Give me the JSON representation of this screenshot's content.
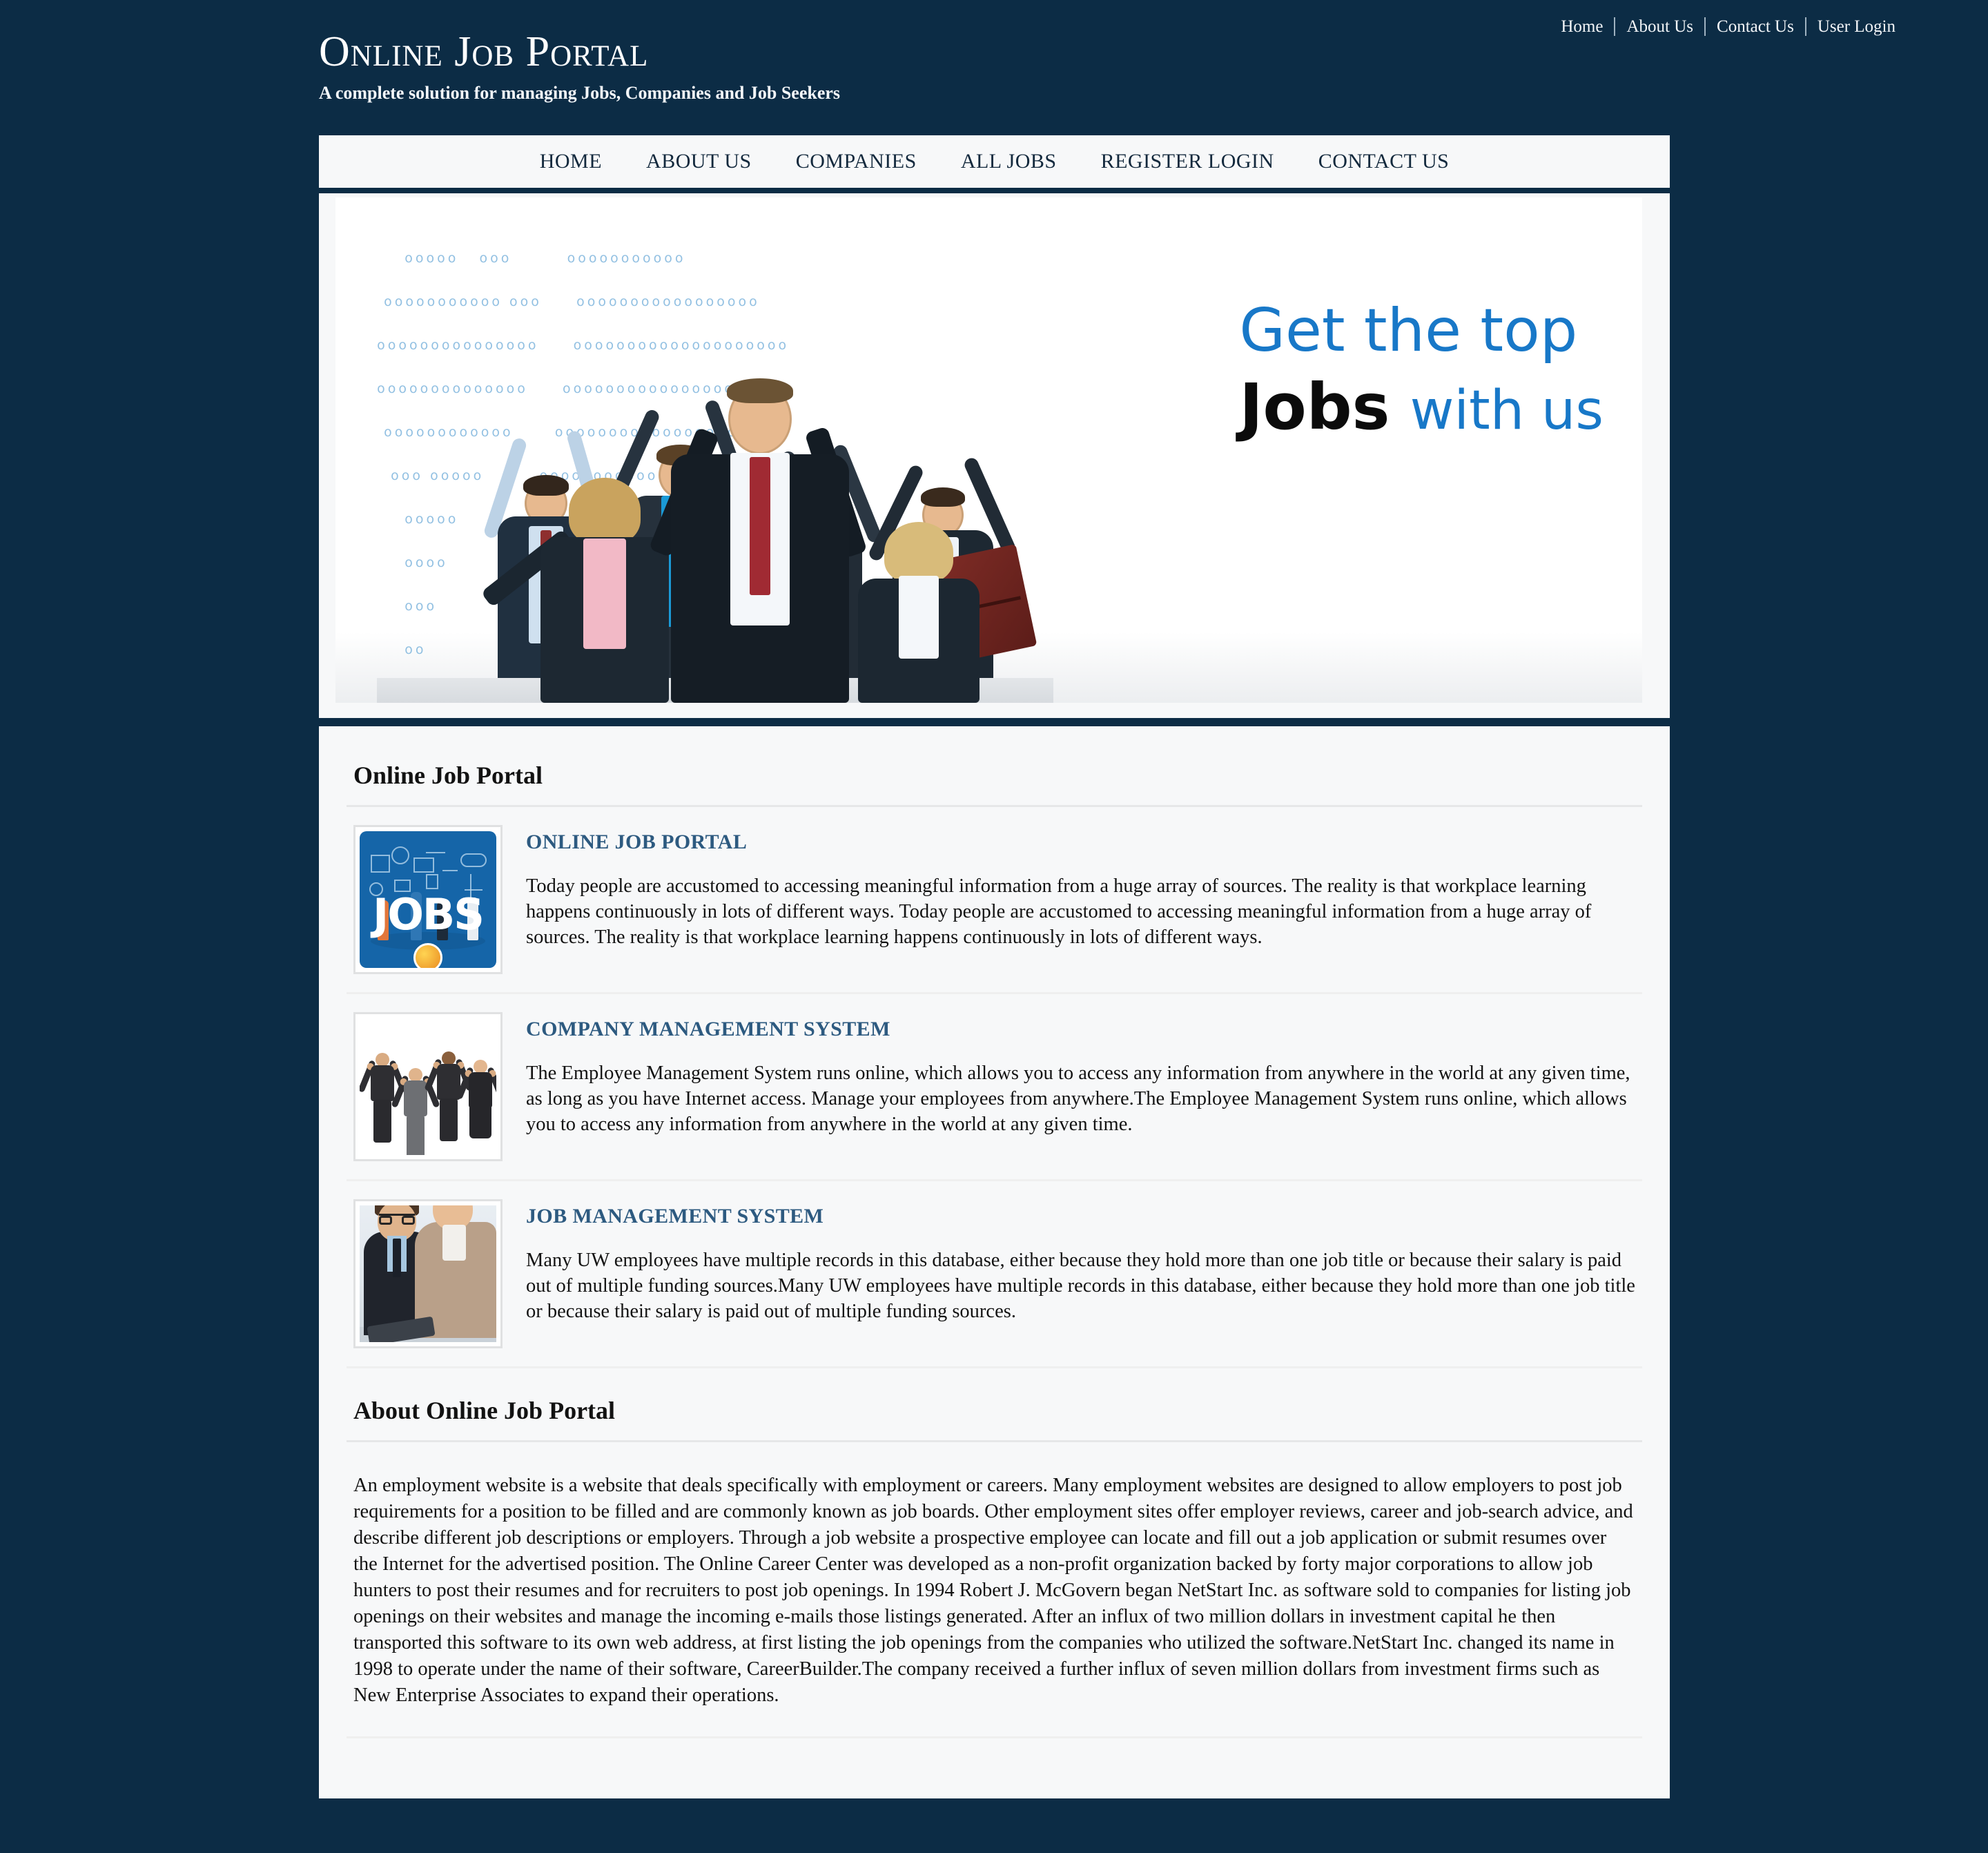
{
  "colors": {
    "page_background": "#0c2c45",
    "panel_background": "#f7f8f9",
    "accent_blue": "#1878c8",
    "heading_blue": "#2d5a80",
    "nav_text": "#13293d"
  },
  "topbar": {
    "links": [
      "Home",
      "About Us",
      "Contact Us",
      "User Login"
    ]
  },
  "brand": {
    "title": "Online Job Portal",
    "tagline": "A complete solution for managing Jobs, Companies and Job Seekers"
  },
  "mainnav": {
    "items": [
      "HOME",
      "ABOUT US",
      "COMPANIES",
      "ALL JOBS",
      "REGISTER LOGIN",
      "CONTACT US"
    ]
  },
  "banner": {
    "line1": "Get the top",
    "line2_bold": "Jobs",
    "line2_rest": "with us",
    "image_alt": "celebrating-business-people-with-dotted-world-map"
  },
  "main": {
    "section_title": "Online Job Portal",
    "features": [
      {
        "title": "ONLINE JOB PORTAL",
        "image_alt": "jobs-illustration-thumbnail",
        "text": "Today people are accustomed to accessing meaningful information from a huge array of sources. The reality is that workplace learning happens continuously in lots of different ways. Today people are accustomed to accessing meaningful information from a huge array of sources. The reality is that workplace learning happens continuously in lots of different ways."
      },
      {
        "title": "COMPANY MANAGEMENT SYSTEM",
        "image_alt": "jumping-business-people-thumbnail",
        "text": "The Employee Management System runs online, which allows you to access any information from anywhere in the world at any given time, as long as you have Internet access. Manage your employees from anywhere.The Employee Management System runs online, which allows you to access any information from anywhere in the world at any given time."
      },
      {
        "title": "JOB MANAGEMENT SYSTEM",
        "image_alt": "two-colleagues-with-tablet-thumbnail",
        "text": "Many UW employees have multiple records in this database, either because they hold more than one job title or because their salary is paid out of multiple funding sources.Many UW employees have multiple records in this database, either because they hold more than one job title or because their salary is paid out of multiple funding sources."
      }
    ],
    "about_title": "About Online Job Portal",
    "about_text": "An employment website is a website that deals specifically with employment or careers. Many employment websites are designed to allow employers to post job requirements for a position to be filled and are commonly known as job boards. Other employment sites offer employer reviews, career and job-search advice, and describe different job descriptions or employers. Through a job website a prospective employee can locate and fill out a job application or submit resumes over the Internet for the advertised position. The Online Career Center was developed as a non-profit organization backed by forty major corporations to allow job hunters to post their resumes and for recruiters to post job openings. In 1994 Robert J. McGovern began NetStart Inc. as software sold to companies for listing job openings on their websites and manage the incoming e-mails those listings generated. After an influx of two million dollars in investment capital he then transported this software to its own web address, at first listing the job openings from the companies who utilized the software.NetStart Inc. changed its name in 1998 to operate under the name of their software, CareerBuilder.The company received a further influx of seven million dollars from investment firms such as New Enterprise Associates to expand their operations."
  }
}
